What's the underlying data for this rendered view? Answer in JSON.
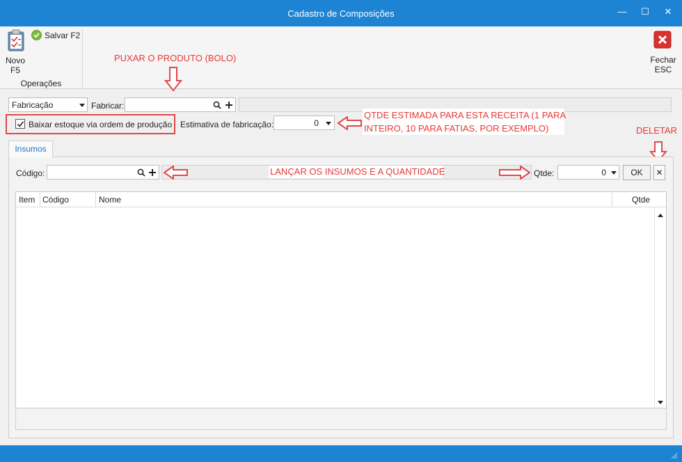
{
  "window": {
    "title": "Cadastro de Composições",
    "minimize_glyph": "—",
    "maximize_glyph": "☐",
    "close_glyph": "✕"
  },
  "ribbon": {
    "novo_label": "Novo",
    "novo_shortcut": "F5",
    "salvar_label": "Salvar F2",
    "group_label": "Operações",
    "fechar_label": "Fechar",
    "fechar_shortcut": "ESC",
    "novo_icon": "clipboard-icon",
    "salvar_icon": "check-circle-icon",
    "fechar_icon": "close-red-icon"
  },
  "form": {
    "type_select_value": "Fabricação",
    "fabricar_label": "Fabricar:",
    "fabricar_value": "",
    "baixar_checkbox_label": "Baixar estoque via ordem de produção",
    "baixar_checked": true,
    "estimativa_label": "Estimativa de fabricação:",
    "estimativa_value": "0"
  },
  "tabs": [
    {
      "label": "Insumos",
      "active": true
    }
  ],
  "insumos": {
    "codigo_label": "Código:",
    "codigo_value": "",
    "qtde_label": "Qtde:",
    "qtde_value": "0",
    "ok_label": "OK",
    "delete_glyph": "✕"
  },
  "grid": {
    "columns": [
      "Item",
      "Código",
      "Nome",
      "Qtde"
    ],
    "rows": []
  },
  "annotations": {
    "puxar": "PUXAR O PRODUTO (BOLO)",
    "qtde_estimada_line1": "QTDE ESTIMADA PARA ESTA RECEITA (1 PARA",
    "qtde_estimada_line2": "INTEIRO, 10 PARA FATIAS, POR EXEMPLO)",
    "deletar": "DELETAR",
    "lancar": "LANÇAR OS INSUMOS E A QUANTIDADE"
  },
  "colors": {
    "titlebar": "#1d84d4",
    "annotation_red": "#e53935",
    "tab_text": "#1d74c4"
  }
}
